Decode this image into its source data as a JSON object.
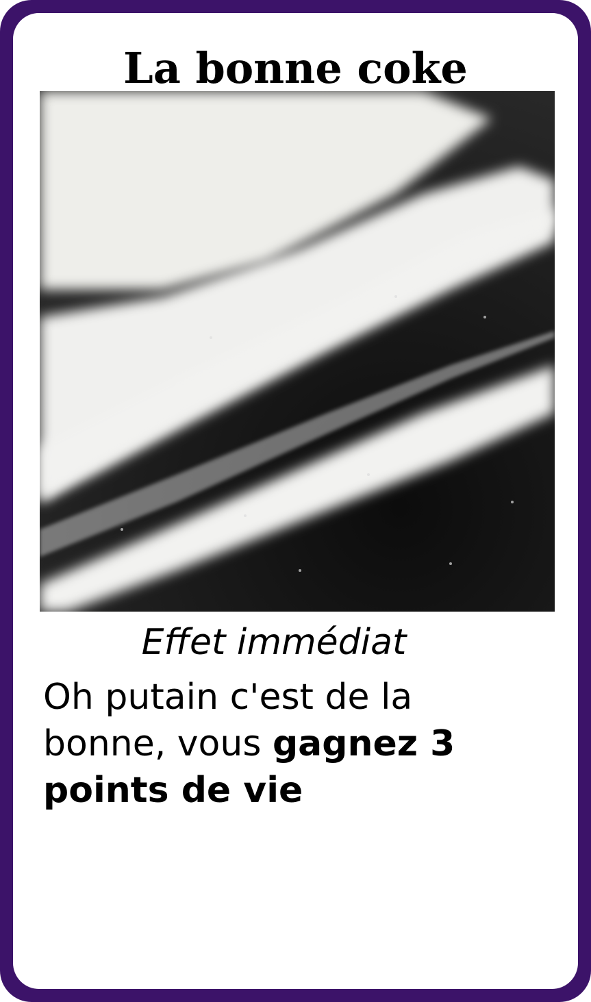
{
  "card": {
    "title": "La bonne coke",
    "subtitle": "Effet immédiat",
    "description_plain": "Oh putain c'est de la bonne, vous ",
    "description_bold": "gagnez 3 points de vie",
    "border_color": "#3c1369"
  }
}
